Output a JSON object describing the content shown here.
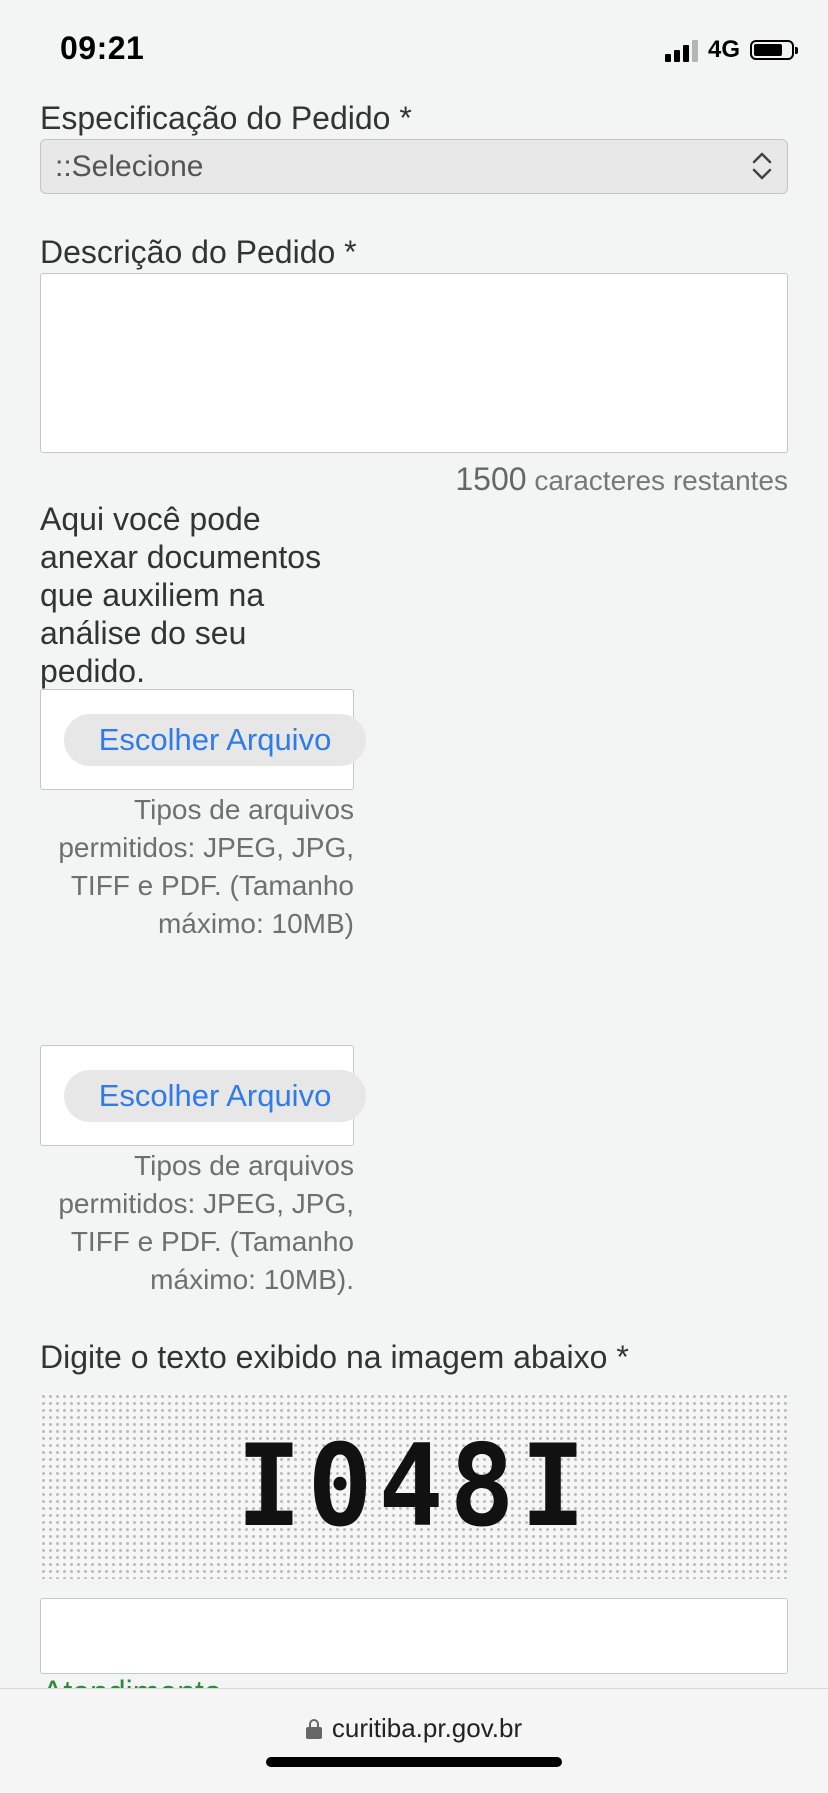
{
  "status_bar": {
    "time": "09:21",
    "network": "4G",
    "icons": [
      "signal-icon",
      "battery-icon"
    ]
  },
  "form": {
    "spec_label": "Especificação do Pedido *",
    "spec_select_value": "::Selecione",
    "desc_label": "Descrição do Pedido *",
    "desc_value": "",
    "char_count": "1500",
    "char_count_suffix": " caracteres restantes",
    "attach_help": "Aqui você pode anexar documentos que auxiliem na análise do seu pedido.",
    "file_inputs": [
      {
        "button_label": "Escolher Arquivo",
        "hint": "Tipos de arquivos permitidos: JPEG, JPG, TIFF e PDF. (Tamanho máximo: 10MB)"
      },
      {
        "button_label": "Escolher Arquivo",
        "hint": "Tipos de arquivos permitidos: JPEG, JPG, TIFF e PDF. (Tamanho máximo: 10MB)."
      }
    ],
    "captcha_label": "Digite o texto exibido na imagem abaixo *",
    "captcha_text": "I048I",
    "captcha_value": "",
    "partial_link": "Atendimento"
  },
  "browser": {
    "url": "curitiba.pr.gov.br",
    "icons": [
      "lock-icon"
    ]
  },
  "colors": {
    "background": "#f3f5f4",
    "link_blue": "#2f7ce8",
    "link_green": "#2e8b3d"
  }
}
